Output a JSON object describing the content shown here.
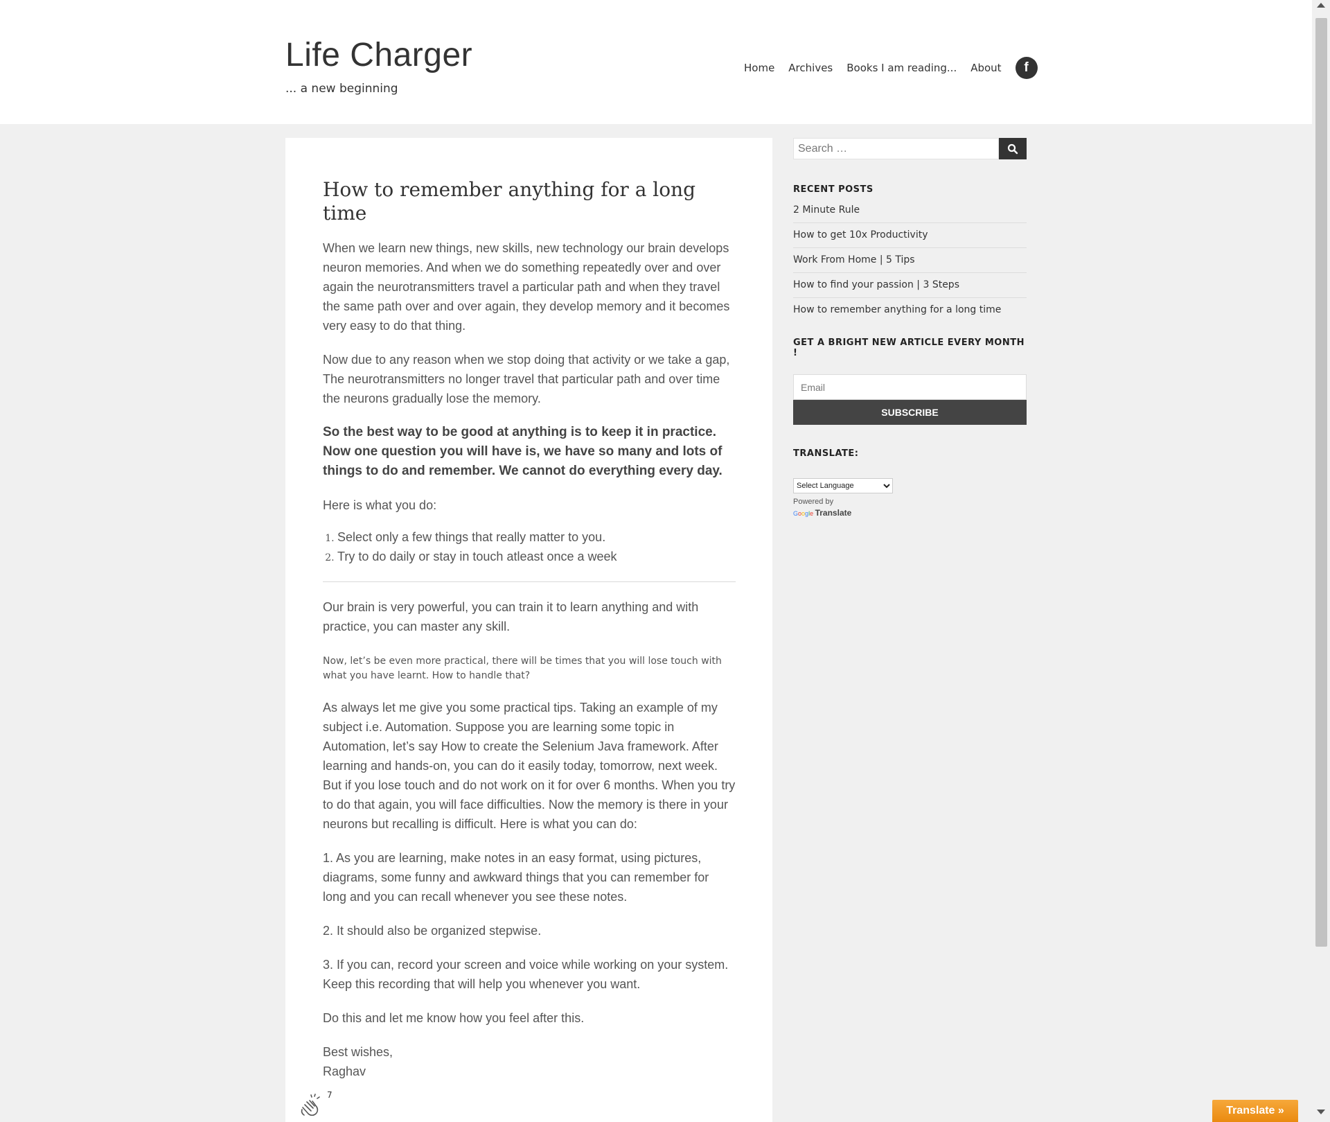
{
  "site": {
    "title": "Life Charger",
    "tagline": "... a new beginning"
  },
  "nav": {
    "items": [
      {
        "label": "Home"
      },
      {
        "label": "Archives"
      },
      {
        "label": "Books I am reading..."
      },
      {
        "label": "About"
      }
    ],
    "social_icon": "facebook-icon",
    "social_glyph": "f"
  },
  "article": {
    "title": "How to remember anything for a long time",
    "p1": "When we learn new things, new skills, new technology our brain develops neuron memories. And when we do something repeatedly over and over again the neurotransmitters travel a particular path and when they travel the same path over and over again, they develop memory and it becomes very easy to do that thing.",
    "p2": "Now due to any reason when we stop doing that activity or we take a gap, The neurotransmitters no longer travel that particular path and over time the neurons gradually lose the memory.",
    "p3_bold": "So the best way to be good at anything is to keep it in practice. Now one question you will have is, we have so many and lots of things to do and remember. We cannot do everything every day.",
    "p4": "Here is what you do:",
    "steps": [
      "Select only a few things that really matter to you.",
      "Try to do daily or stay in touch atleast once a week"
    ],
    "p5": "Our brain is very powerful, you can train it to learn anything and with practice, you can master any skill.",
    "p6_small": "Now, let’s be even more practical, there will be times that you will lose touch with what you have learnt. How to handle that?",
    "p7": "As always let me give you some practical tips. Taking an example of my subject i.e. Automation. Suppose you are learning some topic in Automation, let’s say How to create the Selenium Java framework. After learning and hands-on, you can do it easily today, tomorrow, next week. But if you lose touch and do not work on it for over 6 months. When you try to do that again, you will face difficulties. Now the memory is there in your neurons but recalling is difficult. Here is what you can do:",
    "tip1": "1. As you are learning, make notes in an easy format, using pictures, diagrams, some funny and awkward things that you can remember for long and you can recall whenever you see these notes.",
    "tip2": "2. It should also be organized stepwise.",
    "tip3": "3. If you can, record your screen and voice while working on your system. Keep this recording that will help you whenever you want.",
    "closing": "Do this and let me know how you feel after this.",
    "signoff_line1": "Best wishes,",
    "signoff_line2": "Raghav",
    "clap_count": "7"
  },
  "sidebar": {
    "search_placeholder": "Search …",
    "recent_title": "RECENT POSTS",
    "recent_posts": [
      {
        "label": "2 Minute Rule"
      },
      {
        "label": "How to get 10x Productivity"
      },
      {
        "label": "Work From Home | 5 Tips"
      },
      {
        "label": "How to find your passion | 3 Steps"
      },
      {
        "label": "How to remember anything for a long time"
      }
    ],
    "subscribe_title": "GET A BRIGHT NEW ARTICLE EVERY MONTH !",
    "email_placeholder": "Email",
    "subscribe_label": "SUBSCRIBE",
    "translate_title": "TRANSLATE:",
    "language_select": "Select Language",
    "powered_by": "Powered by",
    "google_logo": "Google",
    "translate_link": "Translate"
  },
  "translate_button": "Translate »",
  "colors": {
    "background": "#f0f0f0",
    "dark_button": "#333333",
    "translate_orange": "#f0961f"
  }
}
